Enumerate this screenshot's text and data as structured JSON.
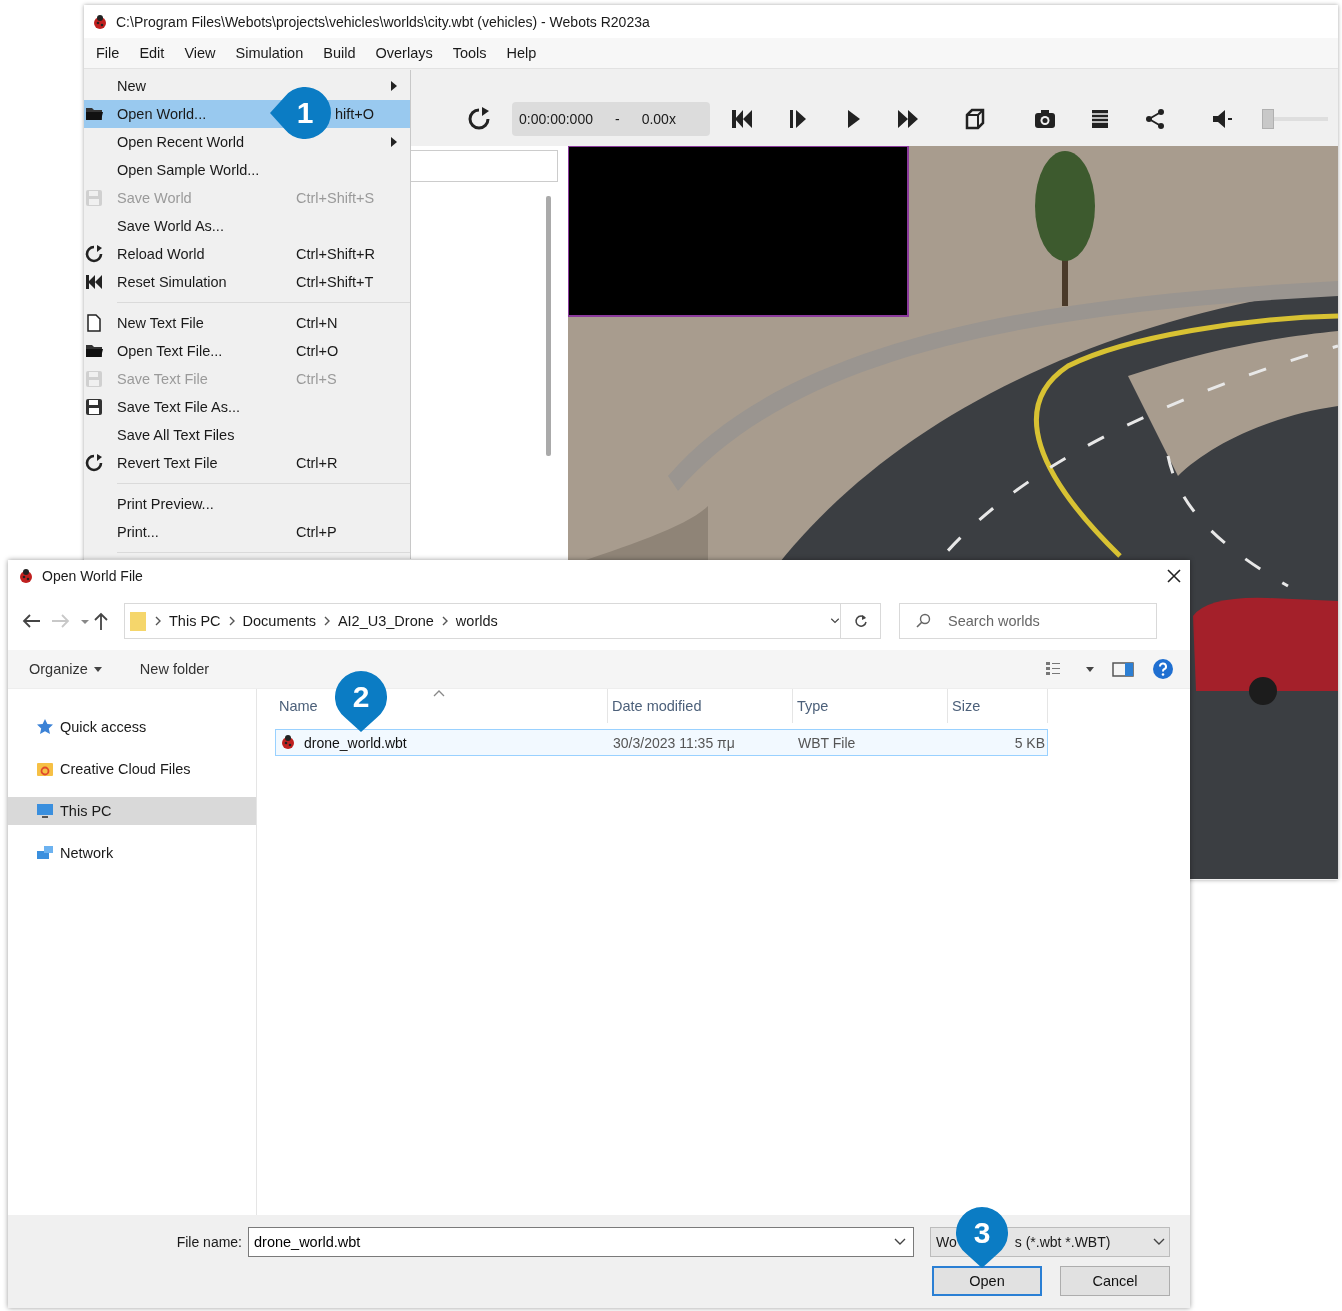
{
  "webots_window": {
    "title": "C:\\Program Files\\Webots\\projects\\vehicles\\worlds\\city.wbt (vehicles) - Webots R2023a",
    "menubar": [
      "File",
      "Edit",
      "View",
      "Simulation",
      "Build",
      "Overlays",
      "Tools",
      "Help"
    ],
    "toolbar": {
      "time": "0:00:00:000",
      "separator": "-",
      "speed": "0.00x"
    },
    "volume_slider": {
      "level": 0
    },
    "file_menu": [
      {
        "kind": "item",
        "label": "New",
        "submenu": true,
        "disabled": false,
        "selected": false
      },
      {
        "kind": "item",
        "label": "Open World...",
        "shortcut": "hift+O",
        "submenu": false,
        "disabled": false,
        "selected": true
      },
      {
        "kind": "item",
        "label": "Open Recent World",
        "submenu": true,
        "disabled": false,
        "selected": false
      },
      {
        "kind": "item",
        "label": "Open Sample World...",
        "submenu": false,
        "disabled": false,
        "selected": false
      },
      {
        "kind": "item",
        "label": "Save World",
        "shortcut": "Ctrl+Shift+S",
        "submenu": false,
        "disabled": true,
        "selected": false
      },
      {
        "kind": "item",
        "label": "Save World As...",
        "submenu": false,
        "disabled": false,
        "selected": false
      },
      {
        "kind": "item",
        "label": "Reload World",
        "shortcut": "Ctrl+Shift+R",
        "submenu": false,
        "disabled": false,
        "selected": false
      },
      {
        "kind": "item",
        "label": "Reset Simulation",
        "shortcut": "Ctrl+Shift+T",
        "submenu": false,
        "disabled": false,
        "selected": false
      },
      {
        "kind": "separator"
      },
      {
        "kind": "item",
        "label": "New Text File",
        "shortcut": "Ctrl+N",
        "submenu": false,
        "disabled": false,
        "selected": false
      },
      {
        "kind": "item",
        "label": "Open Text File...",
        "shortcut": "Ctrl+O",
        "submenu": false,
        "disabled": false,
        "selected": false
      },
      {
        "kind": "item",
        "label": "Save Text File",
        "shortcut": "Ctrl+S",
        "submenu": false,
        "disabled": true,
        "selected": false
      },
      {
        "kind": "item",
        "label": "Save Text File As...",
        "submenu": false,
        "disabled": false,
        "selected": false
      },
      {
        "kind": "item",
        "label": "Save All Text Files",
        "submenu": false,
        "disabled": false,
        "selected": false
      },
      {
        "kind": "item",
        "label": "Revert Text File",
        "shortcut": "Ctrl+R",
        "submenu": false,
        "disabled": false,
        "selected": false
      },
      {
        "kind": "separator"
      },
      {
        "kind": "item",
        "label": "Print Preview...",
        "submenu": false,
        "disabled": false,
        "selected": false
      },
      {
        "kind": "item",
        "label": "Print...",
        "shortcut": "Ctrl+P",
        "submenu": false,
        "disabled": false,
        "selected": false
      },
      {
        "kind": "separator"
      }
    ]
  },
  "open_dialog": {
    "title": "Open World File",
    "path": [
      "This PC",
      "Documents",
      "AI2_U3_Drone",
      "worlds"
    ],
    "search": {
      "placeholder": "Search worlds"
    },
    "commands": [
      {
        "label": "Organize",
        "has_menu": true
      },
      {
        "label": "New folder",
        "has_menu": false
      }
    ],
    "nav": [
      {
        "label": "Quick access",
        "selected": false
      },
      {
        "label": "Creative Cloud Files",
        "selected": false
      },
      {
        "label": "This PC",
        "selected": true
      },
      {
        "label": "Network",
        "selected": false
      }
    ],
    "columns": [
      "Name",
      "Date modified",
      "Type",
      "Size"
    ],
    "files": [
      {
        "name": "drone_world.wbt",
        "date": "30/3/2023 11:35 πμ",
        "type": "WBT File",
        "size": "5 KB",
        "selected": true
      }
    ],
    "file_name_label": "File name:",
    "file_name": "drone_world.wbt",
    "filter": [
      "Wo",
      "s (*.wbt *.WBT)"
    ],
    "buttons": [
      {
        "label": "Open",
        "default": true
      },
      {
        "label": "Cancel",
        "default": false
      }
    ]
  },
  "callouts": [
    "1",
    "2",
    "3"
  ]
}
